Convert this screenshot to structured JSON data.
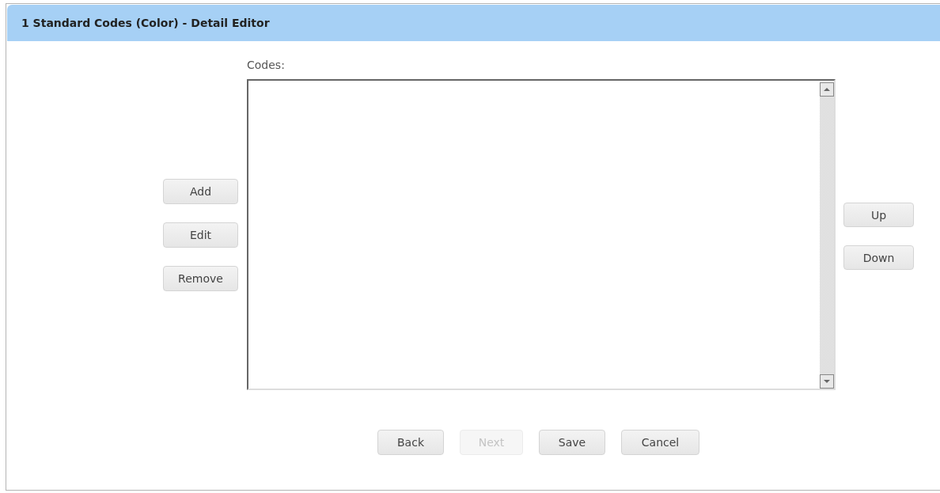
{
  "window": {
    "title": "1 Standard Codes (Color) - Detail Editor"
  },
  "codes_list": {
    "label": "Codes:"
  },
  "left_buttons": [
    {
      "label": "Add",
      "disabled": false
    },
    {
      "label": "Edit",
      "disabled": false
    },
    {
      "label": "Remove",
      "disabled": false
    }
  ],
  "right_buttons": [
    {
      "label": "Up",
      "disabled": false
    },
    {
      "label": "Down",
      "disabled": false
    }
  ],
  "footer_buttons": [
    {
      "label": "Back",
      "disabled": false
    },
    {
      "label": "Next",
      "disabled": true
    },
    {
      "label": "Save",
      "disabled": false
    },
    {
      "label": "Cancel",
      "disabled": false
    }
  ]
}
